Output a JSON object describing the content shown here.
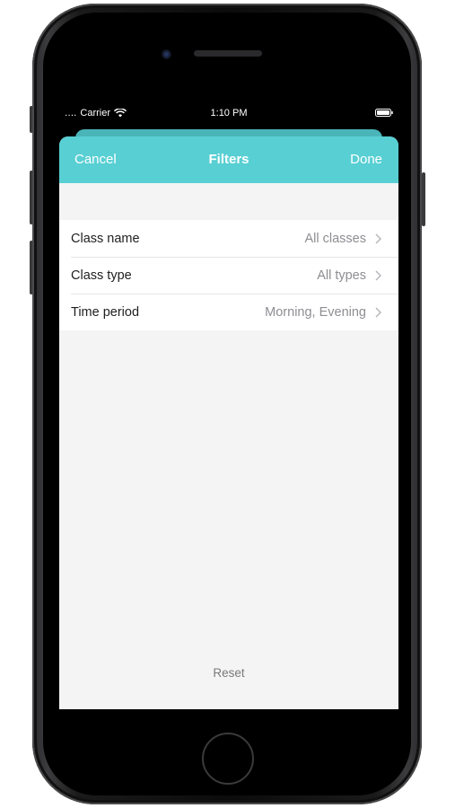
{
  "status_bar": {
    "signal": "․․․․",
    "carrier": "Carrier",
    "time": "1:10 PM"
  },
  "navbar": {
    "cancel_label": "Cancel",
    "title": "Filters",
    "done_label": "Done"
  },
  "filters": [
    {
      "label": "Class name",
      "value": "All classes"
    },
    {
      "label": "Class type",
      "value": "All types"
    },
    {
      "label": "Time period",
      "value": "Morning, Evening"
    }
  ],
  "reset_label": "Reset",
  "colors": {
    "accent": "#58cfd3",
    "sheet_background": "#f4f4f4",
    "value_text": "#8e8e93"
  },
  "icons": [
    "wifi-icon",
    "battery-icon",
    "chevron-right-icon"
  ]
}
